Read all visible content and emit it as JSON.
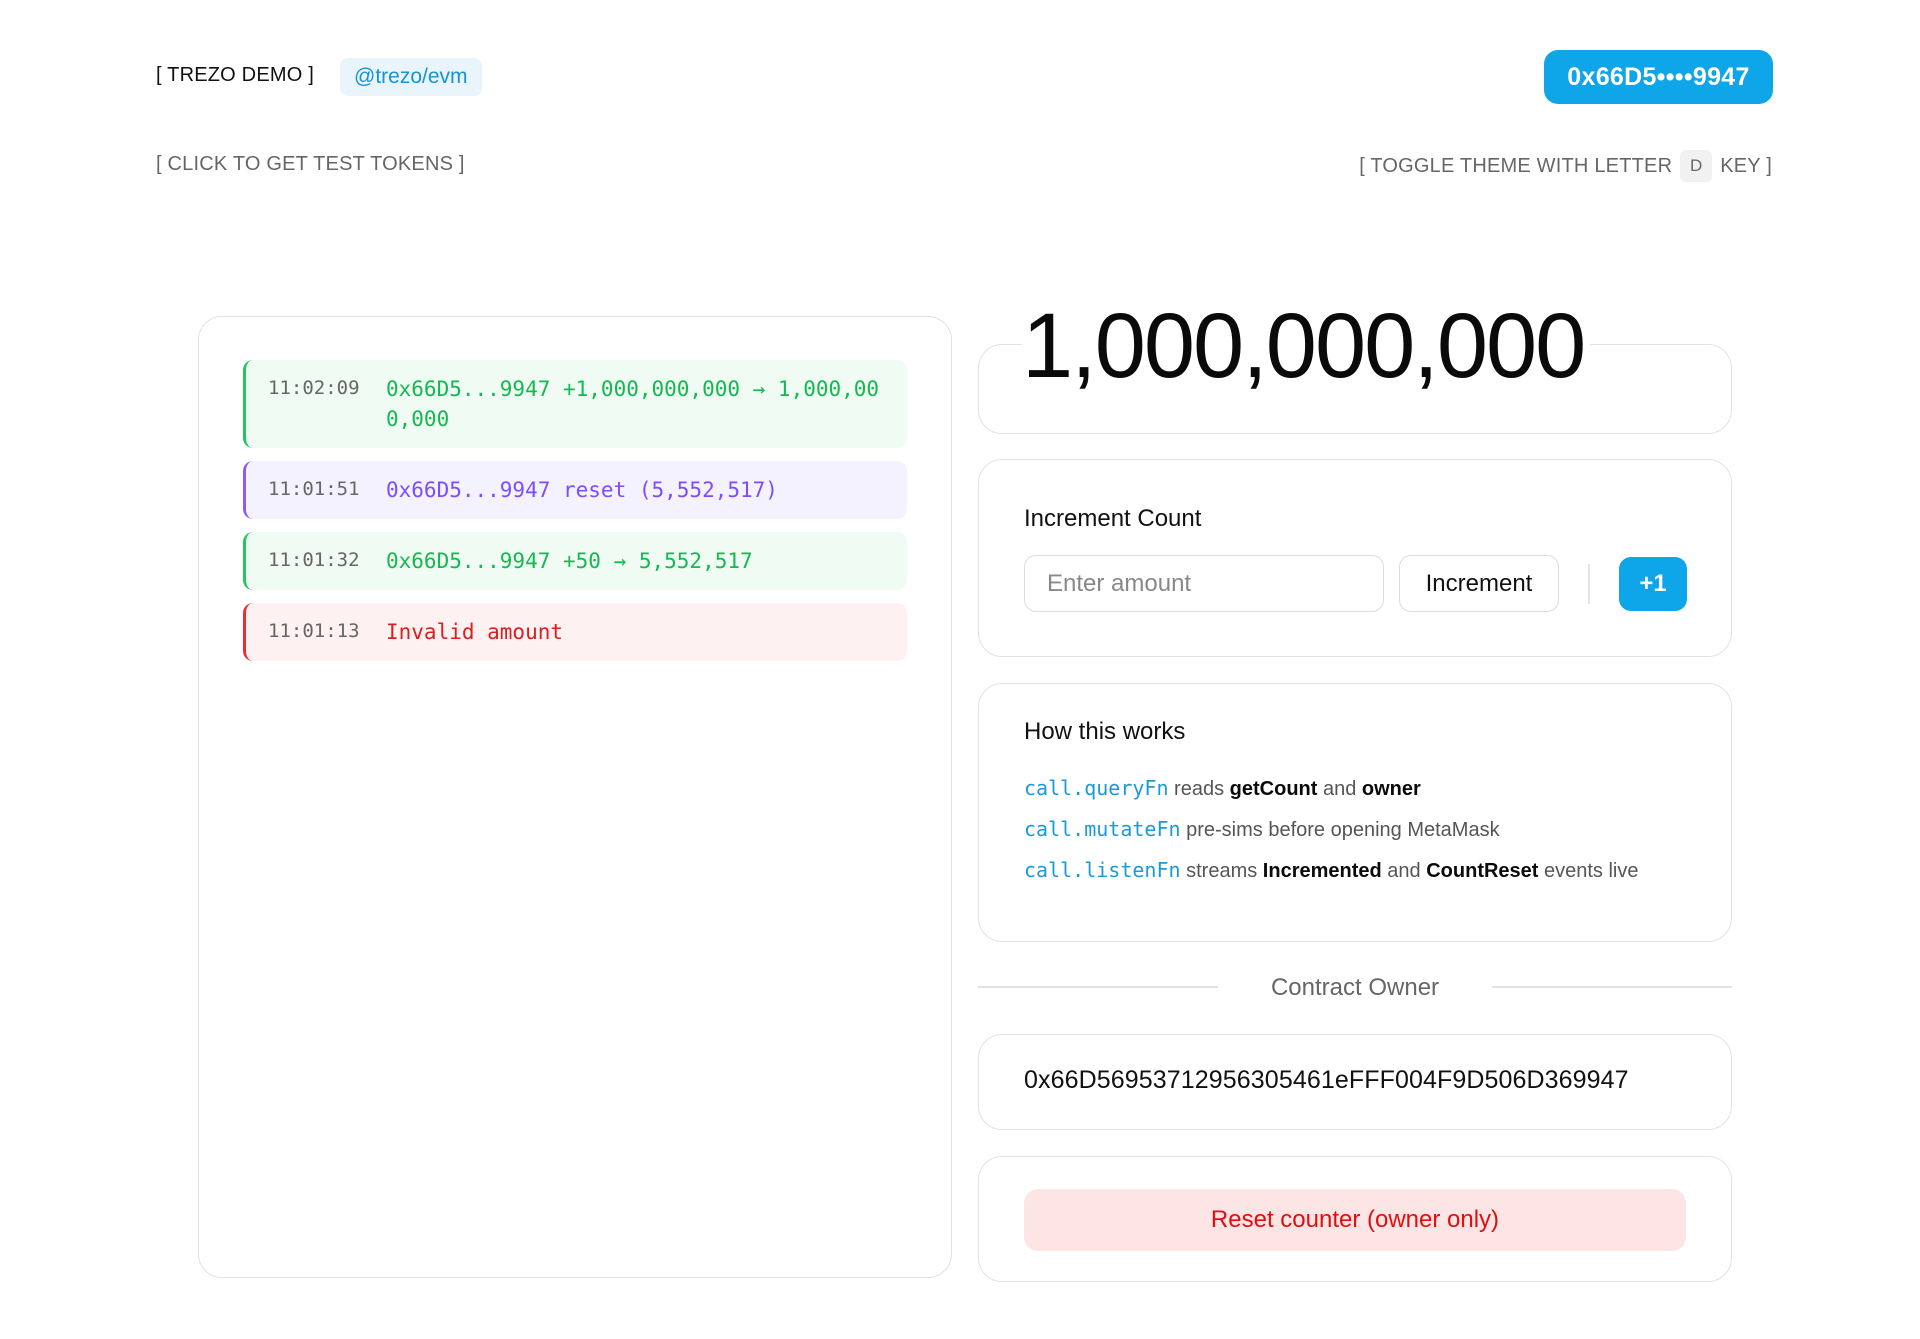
{
  "header": {
    "brand": "[ TREZO DEMO ]",
    "package_tag": "@trezo/evm",
    "wallet_label": "0x66D5••••9947",
    "test_tokens_link": "[ CLICK TO GET TEST TOKENS ]",
    "theme_hint_prefix": "[ TOGGLE THEME WITH LETTER",
    "theme_hint_key": "D",
    "theme_hint_suffix": "KEY ]"
  },
  "log": {
    "entries": [
      {
        "time": "11:02:09",
        "message": "0x66D5...9947 +1,000,000,000 → 1,000,000,000",
        "kind": "success"
      },
      {
        "time": "11:01:51",
        "message": "0x66D5...9947 reset (5,552,517)",
        "kind": "reset"
      },
      {
        "time": "11:01:32",
        "message": "0x66D5...9947 +50 → 5,552,517",
        "kind": "success"
      },
      {
        "time": "11:01:13",
        "message": "Invalid amount",
        "kind": "error"
      }
    ]
  },
  "counter": {
    "value": "1,000,000,000"
  },
  "increment": {
    "title": "Increment Count",
    "input_placeholder": "Enter amount",
    "input_value": "",
    "button_label": "Increment",
    "quick_button_label": "+1"
  },
  "how_it_works": {
    "title": "How this works",
    "items": [
      {
        "fn": "call.queryFn",
        "t1": " reads ",
        "b1": "getCount",
        "t2": " and ",
        "b2": "owner",
        "t3": ""
      },
      {
        "fn": "call.mutateFn",
        "t1": " pre-sims before opening MetaMask",
        "b1": "",
        "t2": "",
        "b2": "",
        "t3": ""
      },
      {
        "fn": "call.listenFn",
        "t1": " streams ",
        "b1": "Incremented",
        "t2": " and ",
        "b2": "CountReset",
        "t3": " events live"
      }
    ]
  },
  "owner": {
    "divider_label": "Contract Owner",
    "address": "0x66D5695371295630546 1eFFF004F9D506D369947"
  },
  "reset": {
    "button_label": "Reset counter (owner only)"
  },
  "colors": {
    "accent": "#0ea5e9",
    "success": "#16b851",
    "reset": "#7c4dff",
    "error": "#dc1e1e"
  }
}
